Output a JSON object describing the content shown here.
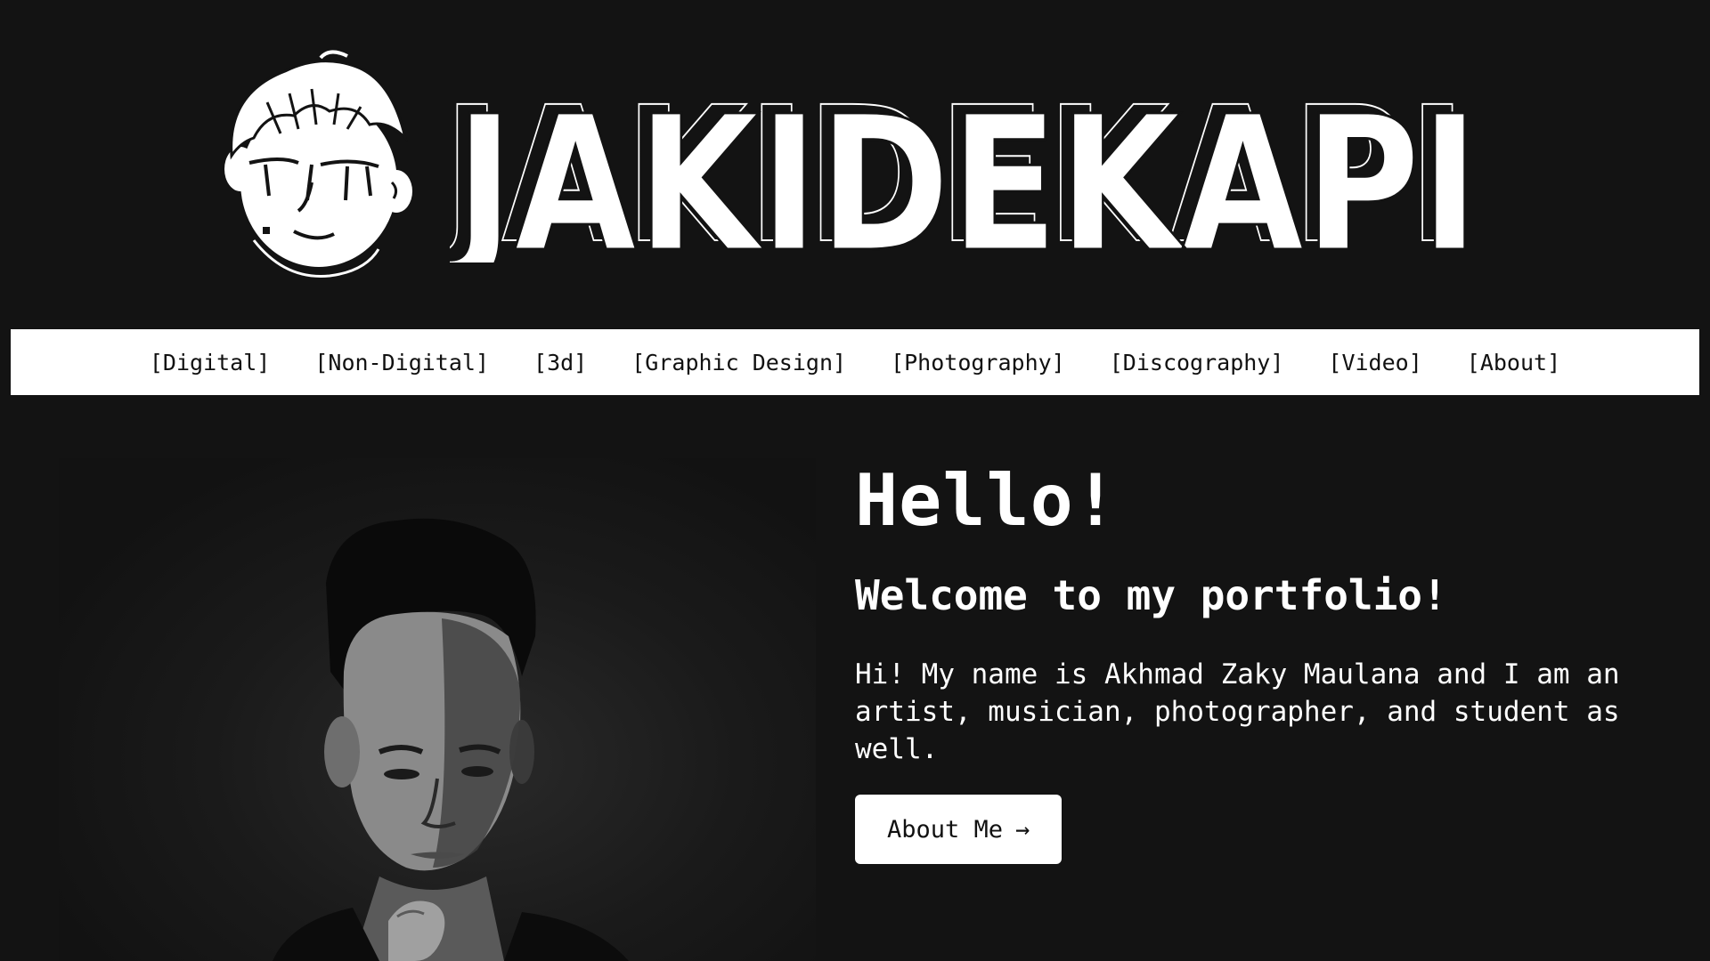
{
  "logo": {
    "wordmark": "JAKIDEKAPI"
  },
  "nav": {
    "items": [
      "[Digital]",
      "[Non-Digital]",
      "[3d]",
      "[Graphic Design]",
      "[Photography]",
      "[Discography]",
      "[Video]",
      "[About]"
    ]
  },
  "hero": {
    "heading": "Hello!",
    "subheading": "Welcome to my portfolio!",
    "intro": "Hi! My name is Akhmad Zaky Maulana and I am an artist, musician, photographer, and student as well.",
    "button_label": "About Me",
    "button_icon": "arrow-right-icon"
  },
  "colors": {
    "background": "#131313",
    "nav_background": "#ffffff",
    "text": "#ffffff",
    "button_text": "#111111"
  }
}
